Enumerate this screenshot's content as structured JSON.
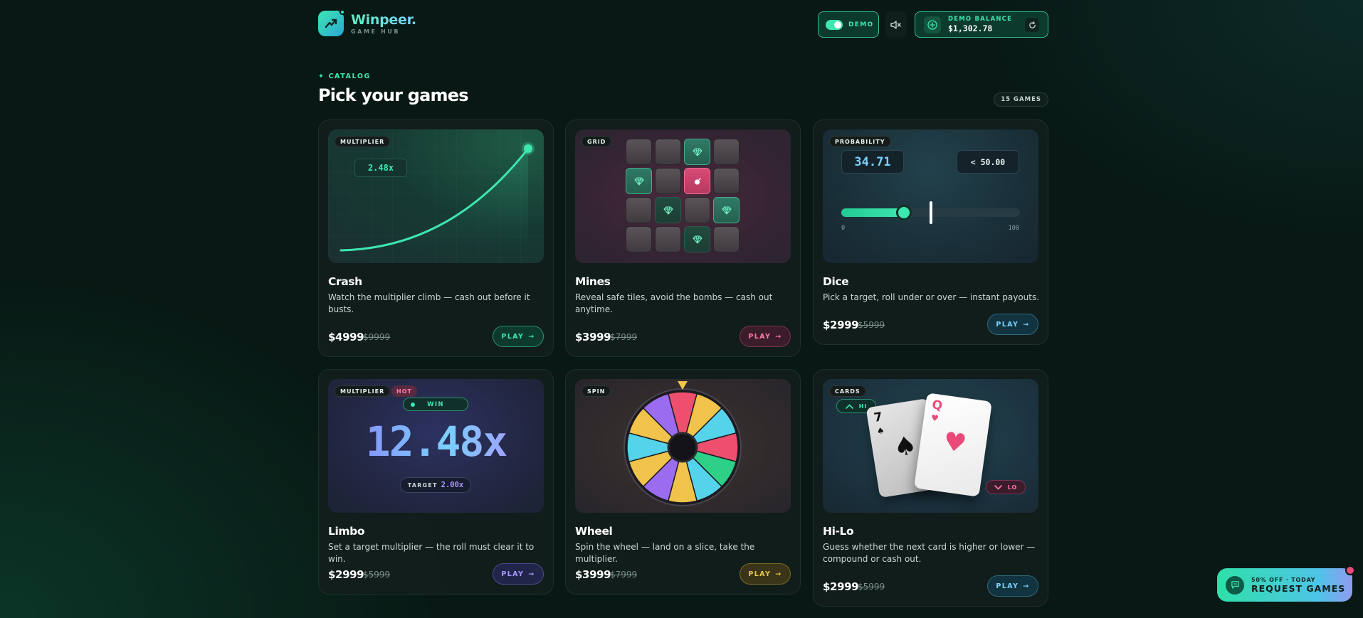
{
  "brand": {
    "name": "Winpeer.",
    "subtitle": "GAME HUB"
  },
  "header": {
    "demo_label": "DEMO",
    "demo_on": true,
    "balance_label": "DEMO BALANCE",
    "balance_value": "$1,302.78"
  },
  "catalog": {
    "eyebrow": "✦ CATALOG",
    "title": "Pick your games",
    "count": "15 GAMES"
  },
  "games": [
    {
      "tag": "MULTIPLIER",
      "title": "Crash",
      "desc": "Watch the multiplier climb — cash out before it busts.",
      "price": "$4999",
      "old_price": "$9999",
      "play": "PLAY",
      "preview": {
        "multiplier": "2.48x"
      }
    },
    {
      "tag": "GRID",
      "title": "Mines",
      "desc": "Reveal safe tiles, avoid the bombs — cash out anytime.",
      "price": "$3999",
      "old_price": "$7999",
      "play": "PLAY"
    },
    {
      "tag": "PROBABILITY",
      "title": "Dice",
      "desc": "Pick a target, roll under or over — instant payouts.",
      "price": "$2999",
      "old_price": "$5999",
      "play": "PLAY",
      "preview": {
        "roll": "34.71",
        "target": "< 50.00",
        "min": "0",
        "max": "100",
        "slider_value": 0.35,
        "target_value": 0.5
      }
    },
    {
      "tag": "MULTIPLIER",
      "hot": "HOT",
      "title": "Limbo",
      "desc": "Set a target multiplier — the roll must clear it to win.",
      "price": "$2999",
      "old_price": "$5999",
      "play": "PLAY",
      "preview": {
        "status": "WIN",
        "multiplier": "12.48x",
        "target_label": "TARGET",
        "target": "2.00x"
      }
    },
    {
      "tag": "SPIN",
      "title": "Wheel",
      "desc": "Spin the wheel — land on a slice, take the multiplier.",
      "price": "$3999",
      "old_price": "$7999",
      "play": "PLAY"
    },
    {
      "tag": "CARDS",
      "title": "Hi-Lo",
      "desc": "Guess whether the next card is higher or lower — compound or cash out.",
      "price": "$2999",
      "old_price": "$5999",
      "play": "PLAY",
      "preview": {
        "hi": "HI",
        "lo": "LO",
        "card1_rank": "7",
        "card1_suit": "♠",
        "card2_rank": "Q",
        "card2_suit": "♥"
      }
    }
  ],
  "fab": {
    "sub": "50% OFF · TODAY",
    "main": "REQUEST GAMES"
  },
  "colors": {
    "accent": "#3ee6b0",
    "mines": "#e94a7a",
    "limbo": "#8b7cf6",
    "wheel": "#e7c84a",
    "dice": "#55d3ea"
  }
}
